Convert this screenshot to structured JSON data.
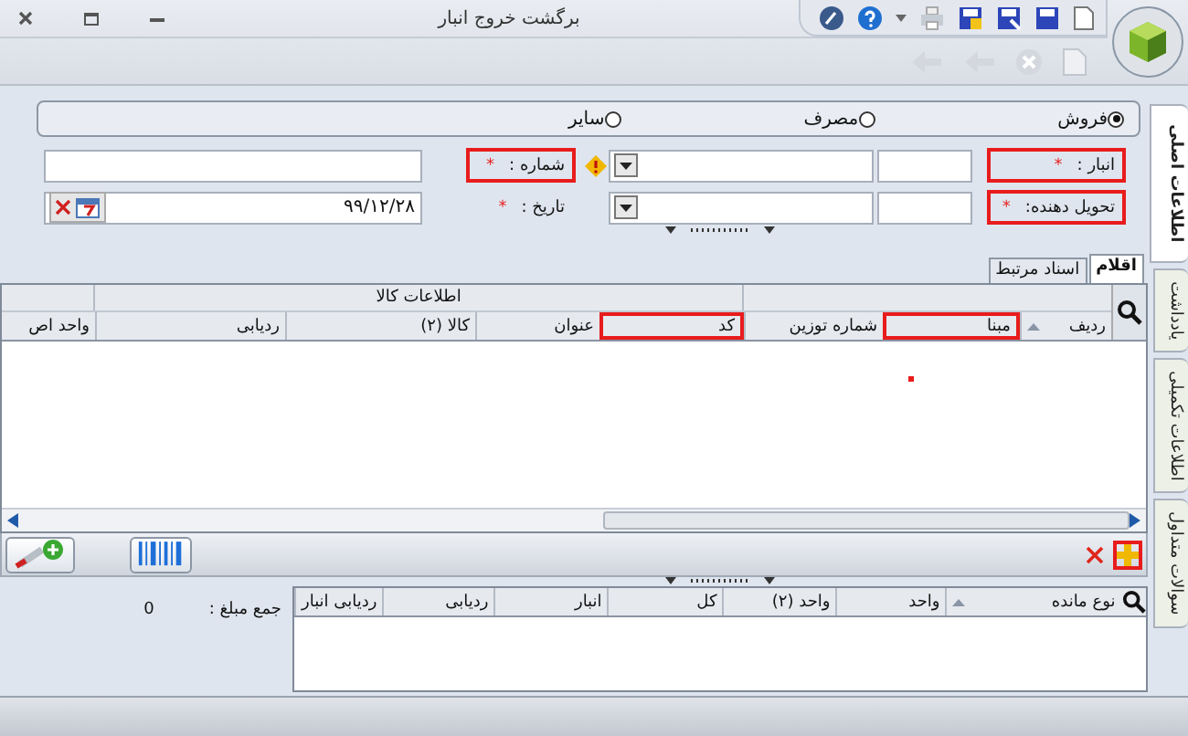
{
  "window": {
    "title": "برگشت خروج انبار"
  },
  "side_tabs": [
    {
      "label": "اطلاعات اصلی",
      "selected": true
    },
    {
      "label": "یادداشت",
      "selected": false
    },
    {
      "label": "اطلاعات تکمیلی",
      "selected": false
    },
    {
      "label": "سوالات متداول",
      "selected": false
    }
  ],
  "radio_options": [
    {
      "label": "فروش",
      "selected": true
    },
    {
      "label": "مصرف",
      "selected": false
    },
    {
      "label": "سایر",
      "selected": false
    }
  ],
  "fields_right": [
    {
      "label": "انبار :",
      "required_mark": "*",
      "highlighted": true
    },
    {
      "label": "تحویل دهنده:",
      "required_mark": "*",
      "highlighted": true
    }
  ],
  "fields_left": [
    {
      "label": "شماره :",
      "required_mark": "*",
      "highlighted": true,
      "kind": "text"
    },
    {
      "label": "تاریخ :",
      "required_mark": "*",
      "highlighted": false,
      "kind": "date",
      "value": "۹۹/۱۲/۲۸"
    }
  ],
  "detail_tabs": [
    {
      "label": "اقلام",
      "selected": true
    },
    {
      "label": "اسناد مرتبط",
      "selected": false
    }
  ],
  "items_grid": {
    "group_header": "اطلاعات کالا",
    "columns": [
      {
        "label": "ردیف",
        "sorted": true,
        "highlighted": false
      },
      {
        "label": "مبنا",
        "sorted": false,
        "highlighted": true
      },
      {
        "label": "شماره توزین",
        "sorted": false,
        "highlighted": false
      },
      {
        "label": "کد",
        "sorted": false,
        "highlighted": true
      },
      {
        "label": "عنوان",
        "sorted": false,
        "highlighted": false
      },
      {
        "label": "کالا (۲)",
        "sorted": false,
        "highlighted": false
      },
      {
        "label": "ردیابی",
        "sorted": false,
        "highlighted": false
      },
      {
        "label": "واحد اص",
        "sorted": false,
        "highlighted": false
      }
    ]
  },
  "items_toolbar": {
    "add_highlighted": true
  },
  "summary": {
    "label": "جمع مبلغ :",
    "value": "0"
  },
  "stock_grid": {
    "columns": [
      {
        "label": "نوع مانده",
        "sorted": true
      },
      {
        "label": "واحد",
        "sorted": false
      },
      {
        "label": "واحد (۲)",
        "sorted": false
      },
      {
        "label": "کل",
        "sorted": false
      },
      {
        "label": "انبار",
        "sorted": false
      },
      {
        "label": "ردیابی",
        "sorted": false
      },
      {
        "label": "ردیابی انبار",
        "sorted": false
      }
    ]
  }
}
